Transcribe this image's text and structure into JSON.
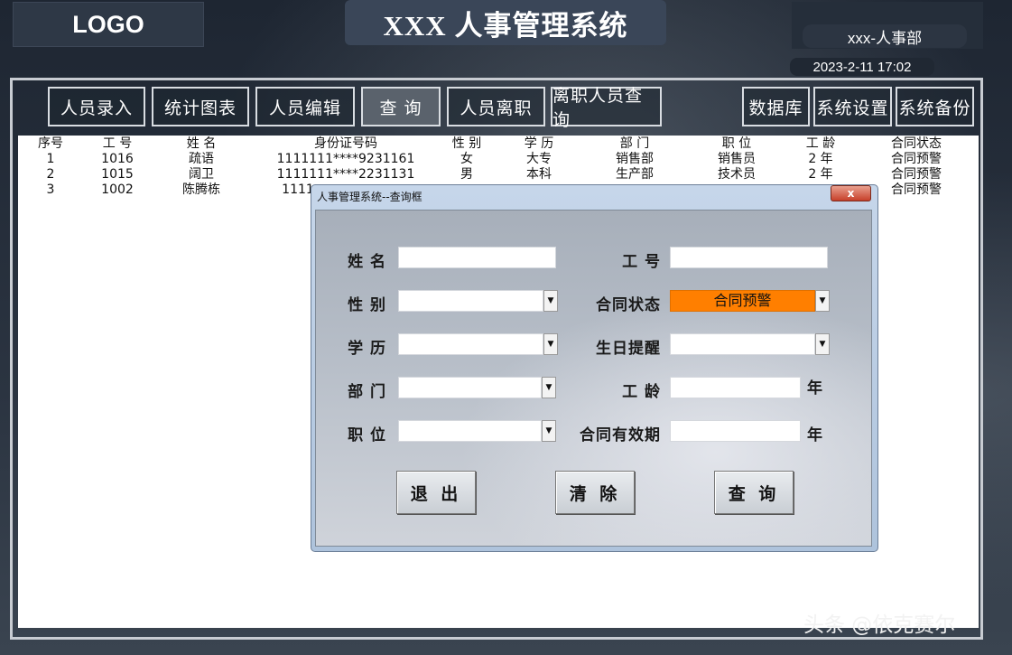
{
  "header": {
    "logo": "LOGO",
    "title": "XXX 人事管理系统",
    "department": "xxx-人事部",
    "datetime": "2023-2-11 17:02"
  },
  "nav": {
    "left": [
      "人员录入",
      "统计图表",
      "人员编辑",
      "查 询",
      "人员离职",
      "离职人员查询"
    ],
    "right": [
      "数据库",
      "系统设置",
      "系统备份"
    ],
    "active_index": 3
  },
  "table": {
    "headers": [
      "序号",
      "工 号",
      "姓 名",
      "身份证号码",
      "性 别",
      "学 历",
      "部 门",
      "职 位",
      "工 龄",
      "合同状态"
    ],
    "rows": [
      [
        "1",
        "1016",
        "疏语",
        "1111111****9231161",
        "女",
        "大专",
        "销售部",
        "销售员",
        "2 年",
        "合同预警"
      ],
      [
        "2",
        "1015",
        "阔卫",
        "1111111****2231131",
        "男",
        "本科",
        "生产部",
        "技术员",
        "2 年",
        "合同预警"
      ],
      [
        "3",
        "1002",
        "陈腾栋",
        "1111",
        "",
        "",
        "",
        "",
        "",
        "合同预警"
      ]
    ]
  },
  "dialog": {
    "title": "人事管理系统--查询框",
    "close": "x",
    "labels": {
      "name": "姓 名",
      "emp_id": "工 号",
      "gender": "性 别",
      "contract_status": "合同状态",
      "education": "学 历",
      "birthday_reminder": "生日提醒",
      "department": "部 门",
      "seniority": "工 龄",
      "position": "职 位",
      "contract_term": "合同有效期"
    },
    "values": {
      "contract_status": "合同预警"
    },
    "units": {
      "seniority": "年",
      "contract_term": "年"
    },
    "buttons": {
      "exit": "退 出",
      "clear": "清 除",
      "query": "查 询"
    },
    "highlight_color": "#ff7f00"
  },
  "watermark": "头条 @依克赛尔"
}
